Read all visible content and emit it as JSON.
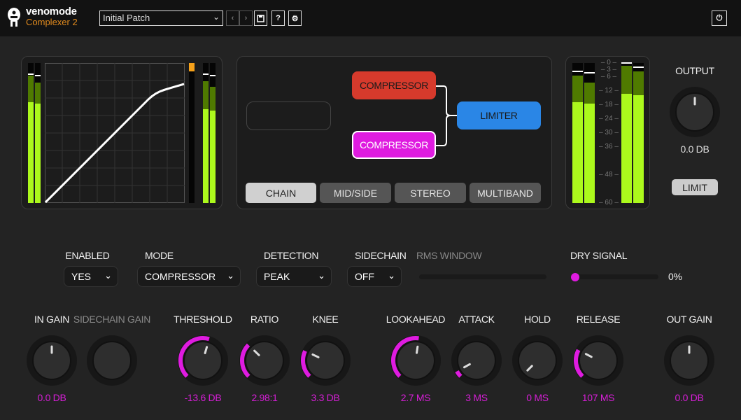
{
  "header": {
    "brand": "venomode",
    "product": "Complexer 2",
    "patch": "Initial Patch",
    "buttons": [
      "prev",
      "next",
      "save",
      "help",
      "settings"
    ],
    "help_label": "?"
  },
  "graph": {
    "type": "transfer-curve",
    "gr_meter_fraction": 0.06
  },
  "input_meters": [
    {
      "peak": 0.91,
      "dark": 0.91,
      "bright": 0.72
    },
    {
      "peak": 0.9,
      "dark": 0.86,
      "bright": 0.71
    }
  ],
  "post_meters": [
    {
      "peak": 0.91,
      "dark": 0.87,
      "bright": 0.67
    },
    {
      "peak": 0.9,
      "dark": 0.83,
      "bright": 0.66
    }
  ],
  "routing": {
    "nodes": [
      {
        "label": "COMPRESSOR",
        "color": "#d63a2c"
      },
      {
        "label": "COMPRESSOR",
        "color": "#df1be0"
      },
      {
        "label": "LIMITER",
        "color": "#2a86e6"
      }
    ],
    "tabs": [
      "CHAIN",
      "MID/SIDE",
      "STEREO",
      "MULTIBAND"
    ],
    "active_tab": "CHAIN"
  },
  "output_meter": {
    "scale": [
      "0",
      "3",
      "6",
      "12",
      "18",
      "24",
      "30",
      "36",
      "48",
      "60"
    ],
    "meters": [
      {
        "peak": 0.93,
        "dark": 0.91,
        "bright": 0.72
      },
      {
        "peak": 0.92,
        "dark": 0.86,
        "bright": 0.71
      },
      {
        "peak": 0.99,
        "dark": 0.98,
        "bright": 0.78
      },
      {
        "peak": 0.96,
        "dark": 0.94,
        "bright": 0.77
      }
    ]
  },
  "output": {
    "label": "OUTPUT",
    "value": "0.0 DB",
    "knob": 0.5,
    "limit_label": "LIMIT"
  },
  "controls": {
    "enabled": {
      "label": "ENABLED",
      "value": "YES"
    },
    "mode": {
      "label": "MODE",
      "value": "COMPRESSOR"
    },
    "detection": {
      "label": "DETECTION",
      "value": "PEAK"
    },
    "sidechain": {
      "label": "SIDECHAIN",
      "value": "OFF"
    },
    "rms_window": {
      "label": "RMS WINDOW"
    },
    "dry_signal": {
      "label": "DRY SIGNAL",
      "value": "0%",
      "fraction": 0
    }
  },
  "knobs": [
    {
      "label": "IN GAIN",
      "value": "0.0 DB",
      "pos": 0.5,
      "arc": false
    },
    {
      "label": "SIDECHAIN GAIN",
      "value": "",
      "pos": null,
      "arc": false,
      "dim": true
    },
    {
      "label": "THRESHOLD",
      "value": "-13.6 DB",
      "pos": 0.56,
      "arc": true
    },
    {
      "label": "RATIO",
      "value": "2.98:1",
      "pos": 0.33,
      "arc": true
    },
    {
      "label": "KNEE",
      "value": "3.3 DB",
      "pos": 0.26,
      "arc": true
    },
    {
      "label": "LOOKAHEAD",
      "value": "2.7 MS",
      "pos": 0.53,
      "arc": true
    },
    {
      "label": "ATTACK",
      "value": "3 MS",
      "pos": 0.06,
      "arc": true
    },
    {
      "label": "HOLD",
      "value": "0 MS",
      "pos": 0.0,
      "arc": false
    },
    {
      "label": "RELEASE",
      "value": "107 MS",
      "pos": 0.27,
      "arc": true
    },
    {
      "label": "OUT GAIN",
      "value": "0.0 DB",
      "pos": 0.5,
      "arc": false
    }
  ],
  "colors": {
    "accent": "#df1be0",
    "meter_bright": "#acf91c",
    "meter_dark": "#4f7a00",
    "gr": "#f5a11a"
  }
}
